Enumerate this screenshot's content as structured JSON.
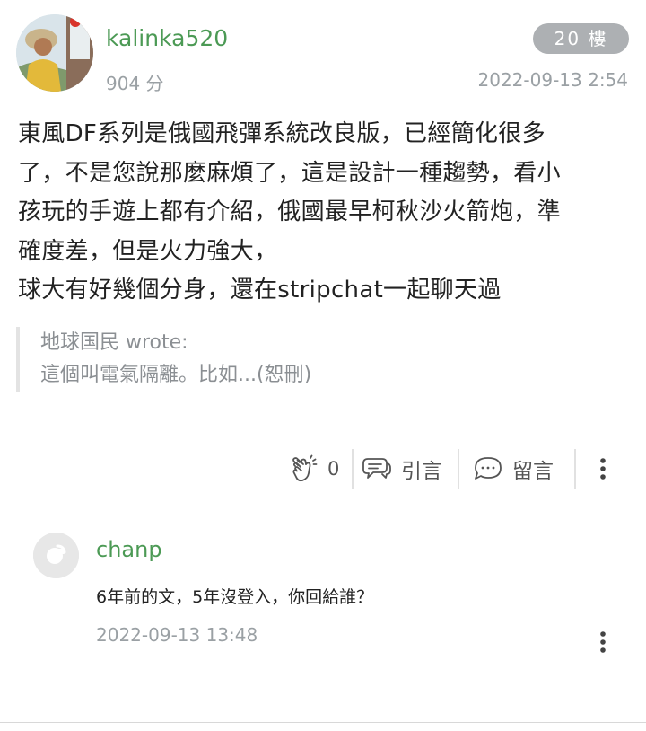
{
  "post": {
    "username": "kalinka520",
    "points": "904 分",
    "floor": "20 樓",
    "timestamp": "2022-09-13 2:54",
    "body_lines": [
      "東風DF系列是俄國飛彈系統改良版，已經簡化很多",
      "了，不是您說那麼麻煩了，這是設計一種趨勢，看小",
      "孩玩的手遊上都有介紹，俄國最早柯秋沙火箭炮，準",
      "確度差，但是火力強大，",
      "球大有好幾個分身，還在stripchat一起聊天過"
    ],
    "quote": {
      "author_line": "地球国民 wrote:",
      "text": "這個叫電氣隔離。比如...(恕刪)"
    },
    "actions": {
      "like_count": "0",
      "quote_label": "引言",
      "comment_label": "留言"
    }
  },
  "comment": {
    "username": "chanp",
    "text": "6年前的文，5年沒登入，你回給誰？",
    "timestamp": "2022-09-13 13:48"
  },
  "icons": [
    "clap-icon",
    "quote-bubble-icon",
    "comment-bubble-icon",
    "more-vertical-icon"
  ],
  "colors": {
    "username": "#4c9a55",
    "badge_bg": "#adb0b3",
    "muted_text": "#9aa0a4"
  }
}
